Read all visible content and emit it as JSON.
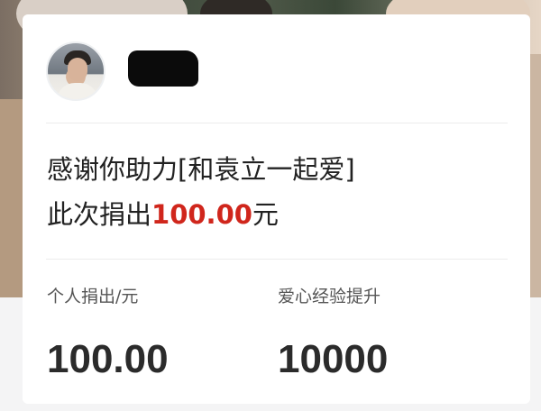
{
  "donation": {
    "thanks_text": "感谢你助力[和袁立一起爱]",
    "donate_prefix": "此次捐出",
    "donate_amount": "100.00",
    "donate_suffix": "元"
  },
  "stats": [
    {
      "label": "个人捐出/元",
      "value": "100.00"
    },
    {
      "label": "爱心经验提升",
      "value": "10000"
    }
  ],
  "colors": {
    "accent": "#d0261c",
    "text": "#222222"
  }
}
